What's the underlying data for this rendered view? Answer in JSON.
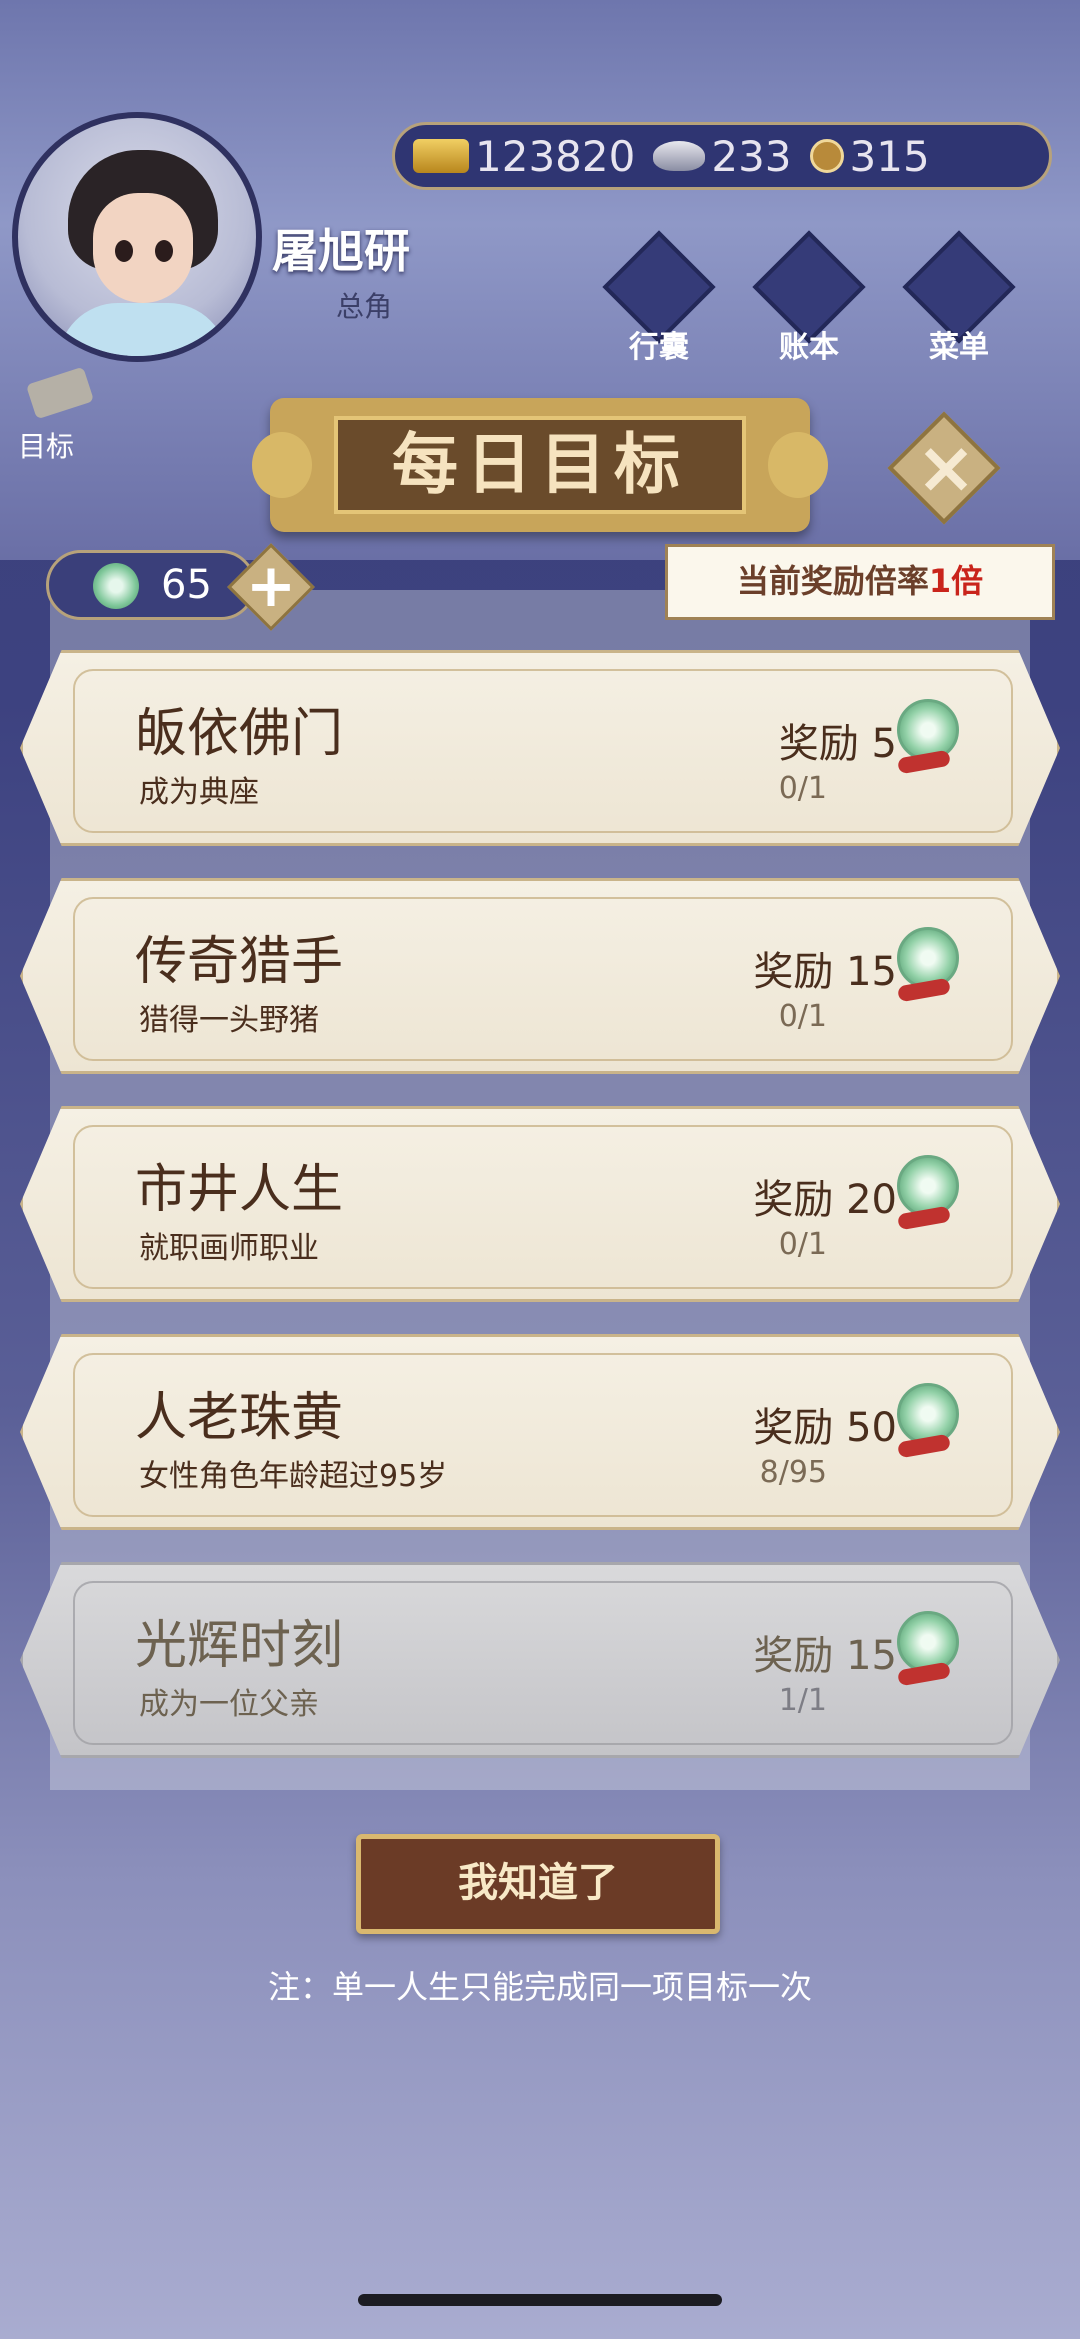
{
  "player": {
    "name": "屠旭研",
    "role": "总角"
  },
  "currency": {
    "gold": "123820",
    "silver": "233",
    "coin": "315"
  },
  "top_buttons": [
    {
      "label": "行囊",
      "icon": "bag-icon"
    },
    {
      "label": "账本",
      "icon": "ledger-icon"
    },
    {
      "label": "菜单",
      "icon": "menu-icon"
    }
  ],
  "side": {
    "goal_label": "目标"
  },
  "panel": {
    "title": "每日目标",
    "jade_count": "65",
    "multiplier_prefix": "当前奖励倍率",
    "multiplier_value": "1倍"
  },
  "goals": [
    {
      "title": "皈依佛门",
      "desc": "成为典座",
      "reward": "奖励 5",
      "progress": "0/1",
      "completed": false
    },
    {
      "title": "传奇猎手",
      "desc": "猎得一头野猪",
      "reward": "奖励 15",
      "progress": "0/1",
      "completed": false
    },
    {
      "title": "市井人生",
      "desc": "就职画师职业",
      "reward": "奖励 20",
      "progress": "0/1",
      "completed": false
    },
    {
      "title": "人老珠黄",
      "desc": "女性角色年龄超过95岁",
      "reward": "奖励 50",
      "progress": "8/95",
      "completed": false
    },
    {
      "title": "光辉时刻",
      "desc": "成为一位父亲",
      "reward": "奖励 15",
      "progress": "1/1",
      "completed": true
    }
  ],
  "confirm_label": "我知道了",
  "note": "注：单一人生只能完成同一项目标一次",
  "colors": {
    "accent_gold": "#d9b86f",
    "multiplier_red": "#c9241b",
    "card_text": "#4a2e1d"
  }
}
